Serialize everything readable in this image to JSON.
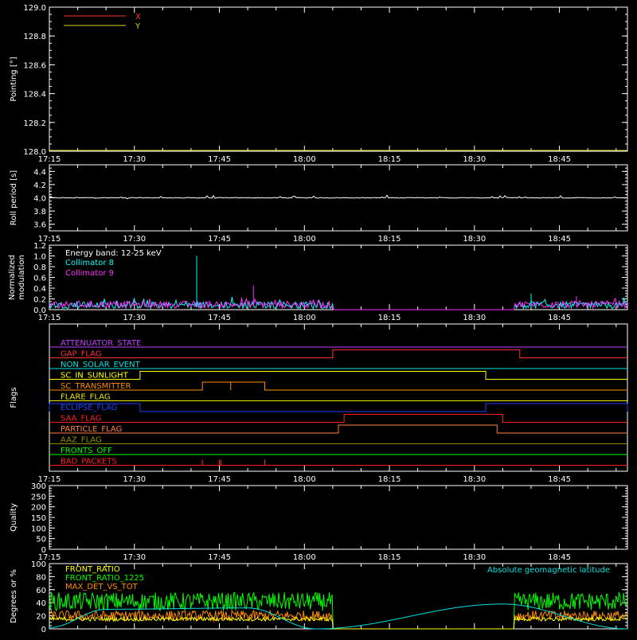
{
  "colors": {
    "background": "#000000",
    "axis": "#ffffff",
    "x_series": "#ff3030",
    "y_series": "#d8d820",
    "roll": "#ffffff",
    "collimator8": "#00ffff",
    "collimator9": "#ff30ff",
    "front_ratio": "#ffff00",
    "front_ratio_1225": "#00ff00",
    "max_det": "#ff8c00",
    "geomag": "#00e0e0"
  },
  "time_axis": {
    "start": "17:15",
    "end": "18:57",
    "ticks": [
      "17:15",
      "17:30",
      "17:45",
      "18:00",
      "18:15",
      "18:30",
      "18:45"
    ]
  },
  "chart_data": [
    {
      "id": "pointing",
      "type": "line",
      "ylabel": "Pointing [°]",
      "ylim": [
        128.0,
        129.0
      ],
      "yticks": [
        "128.0",
        "128.2",
        "128.4",
        "128.6",
        "128.8",
        "129.0"
      ],
      "legend": {
        "position": "top-left",
        "entries": [
          "X",
          "Y"
        ]
      },
      "series": [
        {
          "name": "X",
          "color": "#ff3030",
          "values": []
        },
        {
          "name": "Y",
          "color": "#d8d820",
          "values": []
        }
      ]
    },
    {
      "id": "roll",
      "type": "line",
      "ylabel": "Roll period [s]",
      "ylim": [
        3.5,
        4.5
      ],
      "yticks": [
        "3.6",
        "3.8",
        "4.0",
        "4.2",
        "4.4"
      ],
      "series": [
        {
          "color": "#ffffff",
          "x": [
            "17:15",
            "17:30",
            "17:45",
            "18:00",
            "18:15",
            "18:30",
            "18:45",
            "18:57"
          ],
          "y": [
            4.0,
            4.0,
            4.0,
            4.0,
            4.0,
            4.0,
            4.0,
            4.0
          ]
        }
      ]
    },
    {
      "id": "modulation",
      "type": "line",
      "ylabel": "Normalized modulation",
      "ylim": [
        0.0,
        1.2
      ],
      "yticks": [
        "0.0",
        "0.2",
        "0.4",
        "0.6",
        "0.8",
        "1.0",
        "1.2"
      ],
      "legend": {
        "position": "top-left",
        "title": "Energy band: 12-25 keV",
        "entries": [
          "Collimator 8",
          "Collimator 9"
        ]
      },
      "data_gaps": [
        [
          "18:05",
          "18:37"
        ]
      ],
      "spikes": [
        {
          "series": "Collimator 8",
          "x": "17:41",
          "y": 1.0
        },
        {
          "series": "Collimator 9",
          "x": "17:51",
          "y": 0.45
        },
        {
          "series": "Collimator 8",
          "x": "18:40",
          "y": 0.3
        },
        {
          "series": "Collimator 9",
          "x": "18:48",
          "y": 0.25
        }
      ],
      "baseline": {
        "min": 0.02,
        "max": 0.15
      }
    },
    {
      "id": "flags",
      "type": "line",
      "ylabel": "Flags",
      "flags": [
        {
          "label": "ATTENUATOR_STATE",
          "color": "#c040ff",
          "segments": []
        },
        {
          "label": "GAP_FLAG",
          "color": "#ff3030",
          "segments": [
            [
              "18:05",
              "18:38"
            ]
          ]
        },
        {
          "label": "NON_SOLAR_EVENT",
          "color": "#00e0e0",
          "segments": []
        },
        {
          "label": "SC_IN_SUNLIGHT",
          "color": "#ffff00",
          "segments": [
            [
              "17:31",
              "18:32"
            ]
          ]
        },
        {
          "label": "SC_TRANSMITTER",
          "color": "#ff8c00",
          "segments": [
            [
              "17:42",
              "17:47"
            ],
            [
              "17:47",
              "17:53"
            ]
          ]
        },
        {
          "label": "FLARE_FLAG",
          "color": "#e8e800",
          "segments": []
        },
        {
          "label": "ECLIPSE_FLAG",
          "color": "#2040ff",
          "segments": [
            [
              "17:15",
              "17:31"
            ],
            [
              "18:32",
              "18:57"
            ]
          ]
        },
        {
          "label": "SAA_FLAG",
          "color": "#ff2020",
          "segments": [
            [
              "18:07",
              "18:35"
            ]
          ]
        },
        {
          "label": "PARTICLE_FLAG",
          "color": "#ff8040",
          "segments": [
            [
              "18:06",
              "18:34"
            ]
          ]
        },
        {
          "label": "AAZ_FLAG",
          "color": "#909000",
          "segments": []
        },
        {
          "label": "FRONTS_OFF",
          "color": "#00ff00",
          "segments": []
        },
        {
          "label": "BAD_PACKETS",
          "color": "#ff2020",
          "spikes": [
            "17:42",
            "17:45",
            "17:45",
            "17:53"
          ]
        }
      ]
    },
    {
      "id": "quality",
      "type": "line",
      "ylabel": "Quality",
      "ylim": [
        0,
        300
      ],
      "yticks": [
        "0",
        "50",
        "100",
        "150",
        "200",
        "250",
        "300"
      ],
      "series": [
        {
          "color": "#ffffff",
          "x": [
            "17:15",
            "18:57"
          ],
          "y": [
            0,
            0
          ]
        }
      ]
    },
    {
      "id": "ratios",
      "type": "line",
      "ylabel": "Degrees or %",
      "ylim": [
        0,
        100
      ],
      "yticks": [
        "0",
        "20",
        "40",
        "60",
        "80",
        "100"
      ],
      "legend": {
        "position": "top-left",
        "entries": [
          "FRONT_RATIO",
          "FRONT_RATIO_1225",
          "MAX_DET_VS_TOT"
        ]
      },
      "annotation": "Absolute geomagnetic latitude",
      "data_gaps": [
        [
          "18:05",
          "18:37"
        ]
      ],
      "series": [
        {
          "name": "FRONT_RATIO_1225",
          "color": "#00ff00",
          "mean": 42,
          "spread": 14
        },
        {
          "name": "MAX_DET_VS_TOT",
          "color": "#ff8c00",
          "mean": 20,
          "spread": 8
        },
        {
          "name": "FRONT_RATIO",
          "color": "#ffff00",
          "mean": 15,
          "spread": 3
        },
        {
          "name": "Absolute geomagnetic latitude",
          "color": "#00e0e0",
          "x": [
            "17:15",
            "17:25",
            "17:50",
            "18:02",
            "18:35",
            "18:57"
          ],
          "y": [
            2,
            30,
            32,
            0,
            38,
            0
          ]
        }
      ]
    }
  ]
}
